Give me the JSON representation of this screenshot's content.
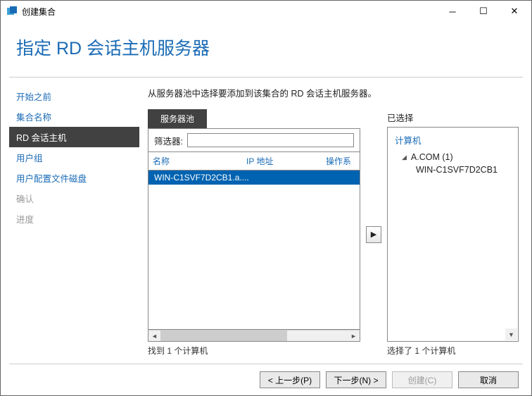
{
  "window": {
    "title": "创建集合"
  },
  "heading": "指定 RD 会话主机服务器",
  "sidebar": {
    "items": [
      {
        "label": "开始之前",
        "state": "done"
      },
      {
        "label": "集合名称",
        "state": "done"
      },
      {
        "label": "RD 会话主机",
        "state": "active"
      },
      {
        "label": "用户组",
        "state": "done"
      },
      {
        "label": "用户配置文件磁盘",
        "state": "done"
      },
      {
        "label": "确认",
        "state": "future"
      },
      {
        "label": "进度",
        "state": "future"
      }
    ]
  },
  "instruction": "从服务器池中选择要添加到该集合的 RD 会话主机服务器。",
  "pool": {
    "tab_label": "服务器池",
    "filter_label": "筛选器:",
    "filter_value": "",
    "columns": {
      "name": "名称",
      "ip": "IP 地址",
      "os": "操作系"
    },
    "rows": [
      {
        "name": "WIN-C1SVF7D2CB1.a...."
      }
    ],
    "status": "找到 1 个计算机"
  },
  "selected": {
    "label": "已选择",
    "header": "计算机",
    "group": "A.COM (1)",
    "items": [
      "WIN-C1SVF7D2CB1"
    ],
    "status": "选择了 1 个计算机"
  },
  "buttons": {
    "prev": "< 上一步(P)",
    "next": "下一步(N) >",
    "create": "创建(C)",
    "cancel": "取消"
  }
}
